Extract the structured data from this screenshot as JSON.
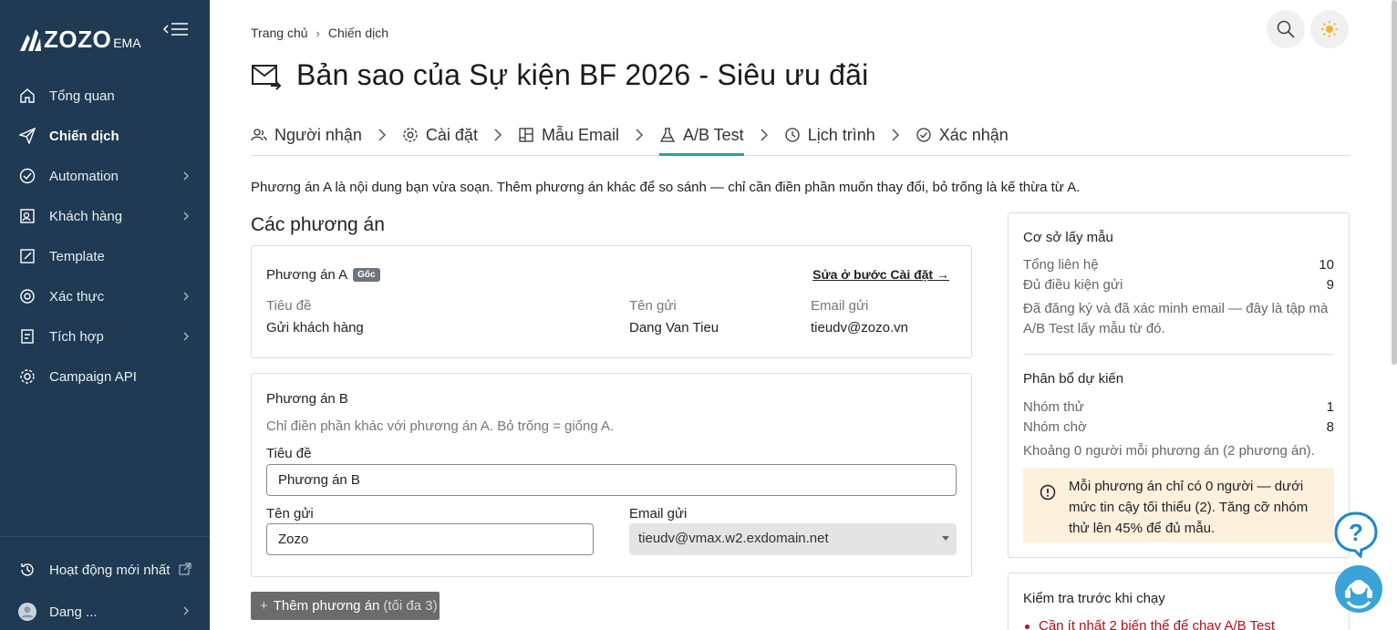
{
  "brand": {
    "logo_text": "ZOZO",
    "logo_sub": "EMA"
  },
  "sidebar": {
    "items": [
      {
        "label": "Tổng quan",
        "icon": "home-icon",
        "has_children": false
      },
      {
        "label": "Chiến dịch",
        "icon": "send-icon",
        "has_children": false,
        "active": true
      },
      {
        "label": "Automation",
        "icon": "automation-icon",
        "has_children": true
      },
      {
        "label": "Khách hàng",
        "icon": "customers-icon",
        "has_children": true
      },
      {
        "label": "Template",
        "icon": "template-icon",
        "has_children": false
      },
      {
        "label": "Xác thực",
        "icon": "verify-icon",
        "has_children": true
      },
      {
        "label": "Tích hợp",
        "icon": "integration-icon",
        "has_children": true
      },
      {
        "label": "Campaign API",
        "icon": "api-gear-icon",
        "has_children": false
      }
    ],
    "recent_activity": "Hoạt động mới nhất",
    "user_name": "Dang ..."
  },
  "breadcrumb": {
    "home": "Trang chủ",
    "current": "Chiến dịch"
  },
  "page_title": "Bản sao của Sự kiện BF 2026 - Siêu ưu đãi",
  "steps": [
    {
      "label": "Người nhận",
      "icon": "people-icon"
    },
    {
      "label": "Cài đặt",
      "icon": "gear-icon"
    },
    {
      "label": "Mẫu Email",
      "icon": "layout-icon"
    },
    {
      "label": "A/B Test",
      "icon": "flask-icon",
      "active": true
    },
    {
      "label": "Lịch trình",
      "icon": "clock-icon"
    },
    {
      "label": "Xác nhận",
      "icon": "check-circle-icon"
    }
  ],
  "intro": "Phương án A là nội dung bạn vừa soạn. Thêm phương án khác để so sánh — chỉ cần điền phần muốn thay đổi, bỏ trống là kế thừa từ A.",
  "variants_title": "Các phương án",
  "variant_a": {
    "title": "Phương án A",
    "badge": "Gốc",
    "edit_link": "Sửa ở bước Cài đặt →",
    "subject_label": "Tiêu đề",
    "subject_value": "Gửi khách hàng",
    "sender_label": "Tên gửi",
    "sender_value": "Dang Van Tieu",
    "email_label": "Email gửi",
    "email_value": "tieudv@zozo.vn"
  },
  "variant_b": {
    "title": "Phương án B",
    "hint": "Chỉ điền phần khác với phương án A. Bỏ trống = giống A.",
    "subject_label": "Tiêu đề",
    "subject_value": "Phương án B",
    "sender_label": "Tên gửi",
    "sender_value": "Zozo",
    "email_label": "Email gửi",
    "email_value": "tieudv@vmax.w2.exdomain.net"
  },
  "add_variant": {
    "label": "Thêm phương án",
    "hint": "(tối đa 3)"
  },
  "sampling": {
    "title": "Cơ sở lấy mẫu",
    "total_label": "Tổng liên hệ",
    "total_value": "10",
    "eligible_label": "Đủ điều kiện gửi",
    "eligible_value": "9",
    "note": "Đã đăng ký và đã xác minh email — đây là tập mà A/B Test lấy mẫu từ đó."
  },
  "allocation": {
    "title": "Phân bổ dự kiến",
    "test_label": "Nhóm thử",
    "test_value": "1",
    "hold_label": "Nhóm chờ",
    "hold_value": "8",
    "note": "Khoảng 0 người mỗi phương án (2 phương án).",
    "warning": "Mỗi phương án chỉ có 0 người — dưới mức tin cậy tối thiểu (2). Tăng cỡ nhóm thử lên 45% để đủ mẫu."
  },
  "precheck": {
    "title": "Kiểm tra trước khi chạy",
    "error": "Cần ít nhất 2 biến thể để chạy A/B Test"
  },
  "colors": {
    "sidebar": "#1f3a52",
    "accent": "#2aa198",
    "warning_bg": "#fdf0dc",
    "error": "#b01020",
    "support": "#3aa3d8"
  }
}
